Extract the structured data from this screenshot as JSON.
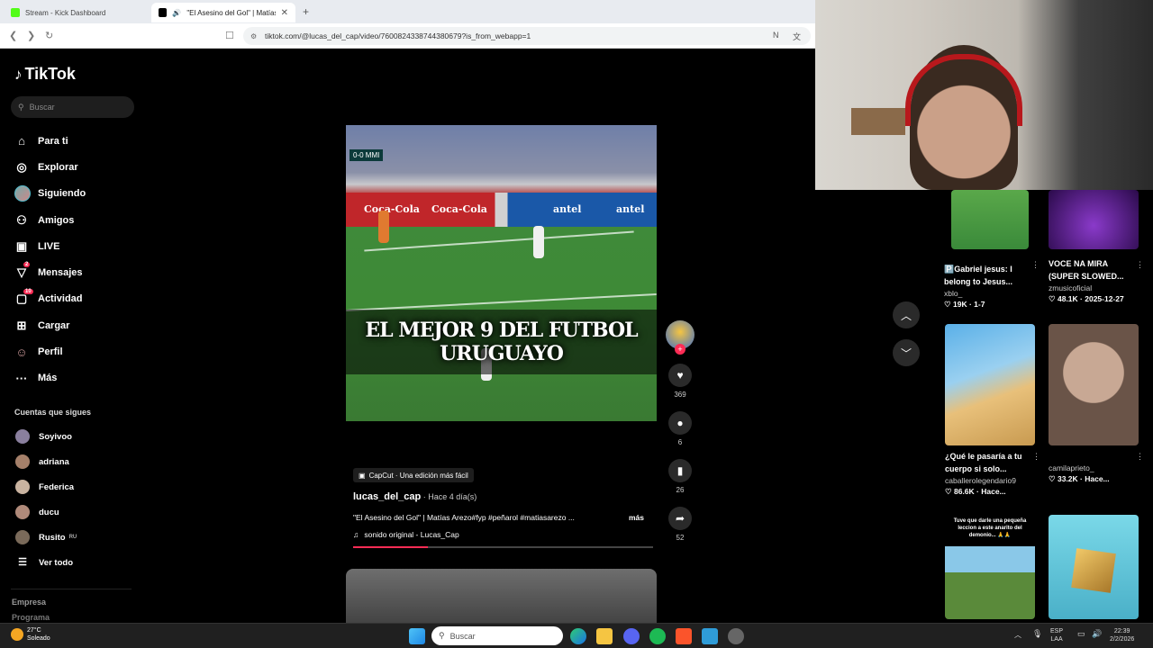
{
  "browser": {
    "tabs": [
      {
        "title": "Stream - Kick Dashboard",
        "active": false,
        "favicon_color": "#53fc18"
      },
      {
        "title": "\"El Asesino del Gol\" | Matías /",
        "active": true,
        "favicon_color": "#000000"
      }
    ],
    "new_tab_symbol": "+",
    "url": "tiktok.com/@lucas_del_cap/video/7600824338744380679?is_from_webapp=1"
  },
  "sidebar": {
    "logo": "TikTok",
    "search_placeholder": "Buscar",
    "nav": [
      {
        "label": "Para ti",
        "icon": "home-icon"
      },
      {
        "label": "Explorar",
        "icon": "compass-icon"
      },
      {
        "label": "Siguiendo",
        "icon": "avatar"
      },
      {
        "label": "Amigos",
        "icon": "friends-icon"
      },
      {
        "label": "LIVE",
        "icon": "live-icon"
      },
      {
        "label": "Mensajes",
        "icon": "messages-icon",
        "badge": "2"
      },
      {
        "label": "Actividad",
        "icon": "activity-icon",
        "badge": "10"
      },
      {
        "label": "Cargar",
        "icon": "upload-icon"
      },
      {
        "label": "Perfil",
        "icon": "profile-icon"
      },
      {
        "label": "Más",
        "icon": "more-icon"
      }
    ],
    "following_title": "Cuentas que sigues",
    "following": [
      {
        "name": "Soyivoo",
        "suffix": "",
        "color": "#8a7f9e"
      },
      {
        "name": "adriana",
        "suffix": "",
        "color": "#a5806a"
      },
      {
        "name": "Federica",
        "suffix": "",
        "color": "#c9b3a0"
      },
      {
        "name": "ducu",
        "suffix": "",
        "color": "#b08a7a"
      },
      {
        "name": "Rusito",
        "suffix": "RU",
        "color": "#7a6a5a"
      }
    ],
    "see_all": "Ver todo",
    "footer": [
      "Empresa",
      "Programa"
    ]
  },
  "video": {
    "scoreboard": "0-0  MMI",
    "ad_texts": [
      "Coca-Cola",
      "antel",
      "antel"
    ],
    "overlay_title": "EL MEJOR 9 DEL FUTBOL URUGUAYO"
  },
  "actions": {
    "likes": "369",
    "comments": "6",
    "saves": "26",
    "shares": "52"
  },
  "caption": {
    "capcut": "CapCut · Una edición más fácil",
    "author": "lucas_del_cap",
    "ago": " · Hace 4 día(s)",
    "description": "\"El Asesino del Gol\" | Matías Arezo#fyp #peñarol #matiasarezo ...",
    "more": "más",
    "sound": "sonido original - Lucas_Cap",
    "progress": 0.25
  },
  "recommendations": [
    {
      "title": "🅿️Gabriel jesus: I belong to Jesus...",
      "user": "xblo_",
      "likes": "19K",
      "date": "1-7",
      "colors": [
        "#3a8a3a",
        "#5aa84a"
      ]
    },
    {
      "title": "VOCE NA MIRA (SUPER SLOWED...",
      "user": "zmusicoficial",
      "likes": "48.1K",
      "date": "2025-12-27",
      "colors": [
        "#2a0a4a",
        "#8a3aca"
      ]
    },
    {
      "title": "¿Qué le pasaría a tu cuerpo si solo...",
      "user": "caballerolegendario9",
      "likes": "86.6K",
      "date": "Hace...",
      "colors": [
        "#5ab0e8",
        "#e8c07a"
      ]
    },
    {
      "title": "",
      "user": "camilaprieto_",
      "likes": "33.2K",
      "date": "Hace...",
      "colors": [
        "#c8a894",
        "#6a5448"
      ]
    },
    {
      "title": "",
      "user": "",
      "likes": "",
      "date": "",
      "caption": "Tuve que darle una pequeña leccion a este anarito del demonio... 🙏🙏",
      "colors": [
        "#ffffff",
        "#5a8a3a"
      ]
    },
    {
      "title": "",
      "user": "",
      "likes": "",
      "date": "",
      "colors": [
        "#5ac8d8",
        "#d8a848"
      ]
    }
  ],
  "taskbar": {
    "temperature": "27°C",
    "weather": "Soleado",
    "search": "Buscar",
    "lang": "ESP",
    "lang2": "LAA",
    "time": "22:39",
    "date": "2/2/2026"
  }
}
